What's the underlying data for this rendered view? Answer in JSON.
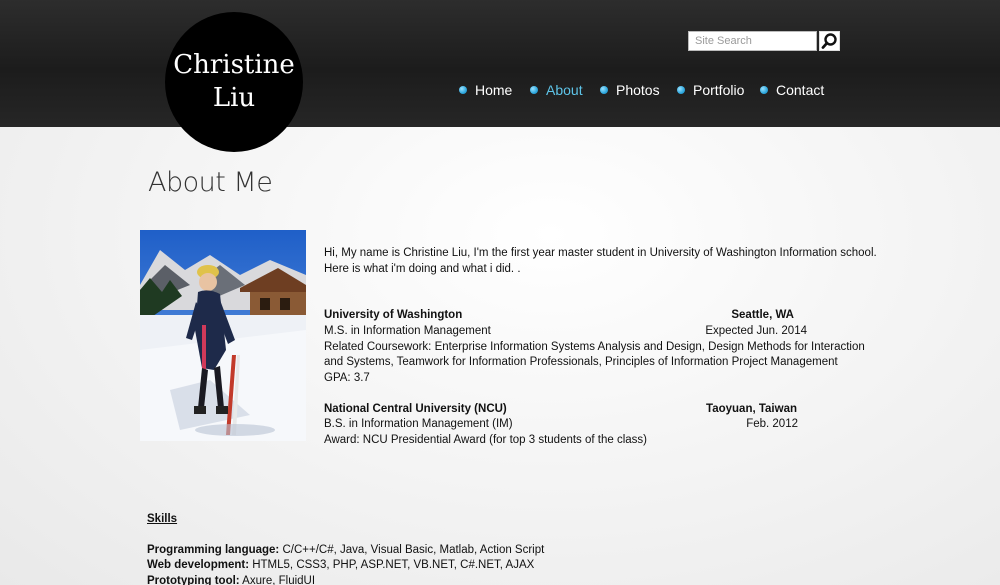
{
  "header": {
    "logo_line1": "Christine",
    "logo_line2": "Liu",
    "search_placeholder": "Site Search",
    "nav": [
      {
        "label": "Home",
        "active": false
      },
      {
        "label": "About",
        "active": true
      },
      {
        "label": "Photos",
        "active": false
      },
      {
        "label": "Portfolio",
        "active": false
      },
      {
        "label": "Contact",
        "active": false
      }
    ]
  },
  "colors": {
    "accent": "#5ec4e8",
    "header_bg": "#222222",
    "bullet": "#2ea8df"
  },
  "main": {
    "title": "About Me",
    "intro_line1": "Hi, My name is Christine Liu, I'm the first year master student in University of Washington Information school.",
    "intro_line2": "Here is what i'm doing and what i did. .",
    "education": [
      {
        "school": "University of Washington",
        "location": "Seattle, WA",
        "degree": "M.S. in Information Management",
        "date": "Expected Jun. 2014",
        "coursework_line1": "Related Coursework: Enterprise Information Systems Analysis and Design, Design Methods for Interaction",
        "coursework_line2": "and Systems, Teamwork for Information Professionals, Principles of Information Project Management",
        "gpa": "GPA: 3.7"
      },
      {
        "school": "National Central University (NCU)",
        "location": "Taoyuan, Taiwan",
        "degree": "B.S. in Information Management (IM)",
        "date": "Feb. 2012",
        "award": "Award: NCU Presidential Award (for top 3 students of the class)"
      }
    ],
    "skills": {
      "heading": "Skills",
      "items": [
        {
          "label": "Programming language:",
          "value": " C/C++/C#, Java, Visual Basic, Matlab, Action Script"
        },
        {
          "label": "Web development:",
          "value": " HTML5, CSS3, PHP, ASP.NET, VB.NET, C#.NET, AJAX"
        },
        {
          "label": "Prototyping tool:",
          "value": " Axure, FluidUI"
        }
      ]
    }
  },
  "icons": {
    "search_button": "magnifier-icon",
    "nav_bullet": "circle-bullet-icon",
    "photo": "profile-photo-skiing"
  }
}
